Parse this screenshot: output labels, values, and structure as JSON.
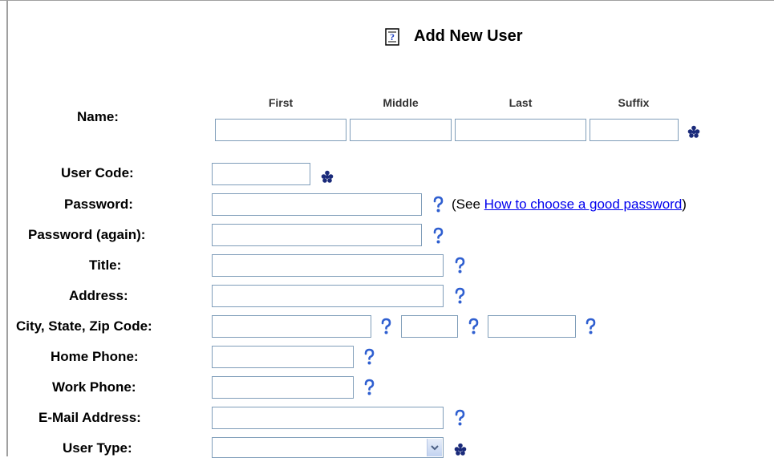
{
  "page": {
    "title": "Add New User",
    "title_icon": "document-help-icon"
  },
  "name_section": {
    "label": "Name:",
    "columns": [
      "First",
      "Middle",
      "Last",
      "Suffix"
    ],
    "values": [
      "",
      "",
      "",
      ""
    ]
  },
  "fields": {
    "user_code": {
      "label": "User Code:",
      "value": ""
    },
    "password": {
      "label": "Password:",
      "value": ""
    },
    "password_again": {
      "label": "Password (again):",
      "value": ""
    },
    "title": {
      "label": "Title:",
      "value": ""
    },
    "address": {
      "label": "Address:",
      "value": ""
    },
    "city_state_zip": {
      "label": "City, State, Zip Code:",
      "city": "",
      "state": "",
      "zip": ""
    },
    "home_phone": {
      "label": "Home Phone:",
      "value": ""
    },
    "work_phone": {
      "label": "Work Phone:",
      "value": ""
    },
    "email": {
      "label": "E-Mail Address:",
      "value": ""
    },
    "user_type": {
      "label": "User Type:",
      "selected": ""
    }
  },
  "password_help": {
    "prefix": "(See ",
    "link_text": "How to choose a good password",
    "suffix": ")"
  },
  "icons": {
    "help": "question-mark-icon",
    "required": "asterisk-required-icon"
  },
  "colors": {
    "help_icon": "#2f5fd0",
    "required_icon": "#1a2a7a",
    "link": "#0000ee",
    "input_border": "#7f9db9"
  }
}
